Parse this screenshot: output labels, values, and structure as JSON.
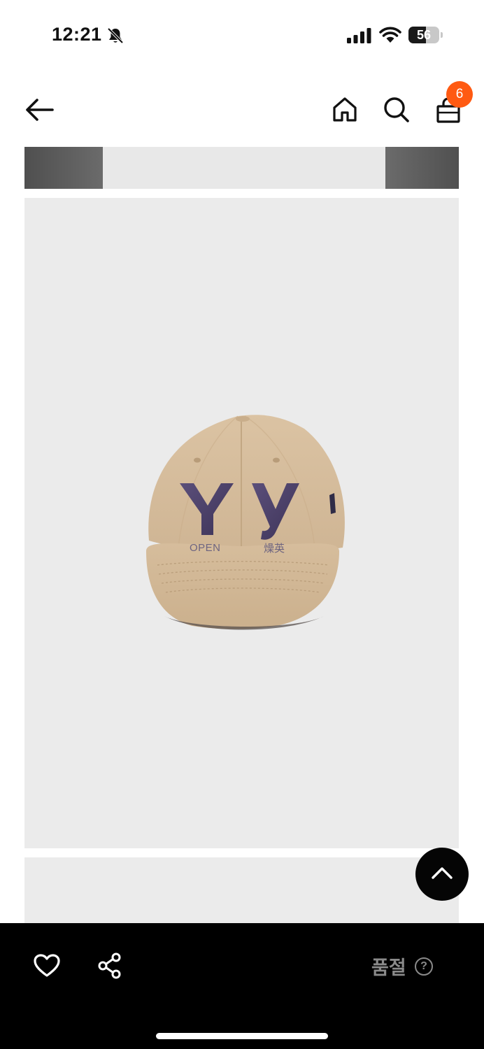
{
  "status_bar": {
    "time": "12:21",
    "battery": "56",
    "battery_fraction": 0.56
  },
  "nav": {
    "cart_count": "6"
  },
  "product": {
    "cap_label_left": "OPEN",
    "cap_label_right": "燥英",
    "cap_letters": "Yy"
  },
  "bottom_bar": {
    "status_label": "품절",
    "help_glyph": "?"
  },
  "colors": {
    "badge": "#ff5a12",
    "bottom_bar": "#000000",
    "status_text": "#8a8a8a",
    "image_bg": "#ebebeb"
  }
}
